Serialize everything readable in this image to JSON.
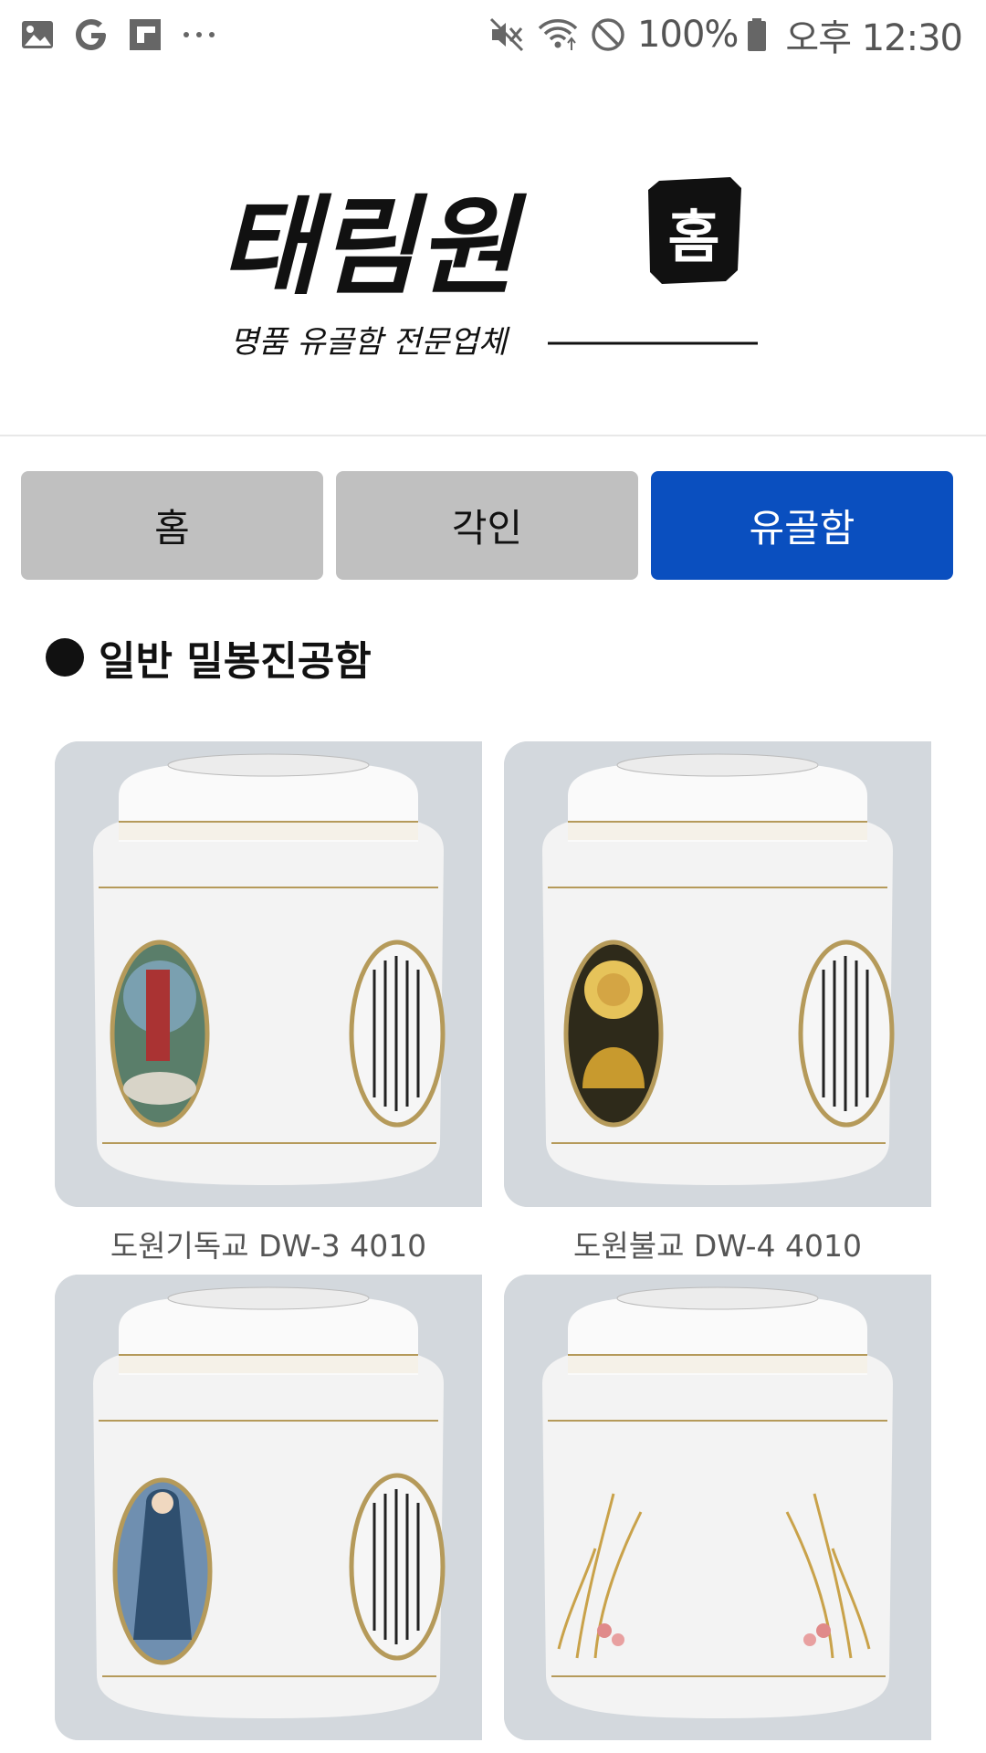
{
  "status_bar": {
    "left_icons": [
      "gallery-icon",
      "google-icon",
      "flipboard-icon",
      "more-dots-icon"
    ],
    "right_icons": [
      "mute-icon",
      "wifi-icon",
      "dnd-icon",
      "battery-icon"
    ],
    "battery": "100%",
    "time": "오후 12:30"
  },
  "header": {
    "logo_title": "태림원",
    "logo_seal": "홈",
    "logo_tagline": "명품 유골함 전문업체"
  },
  "nav": {
    "tabs": [
      {
        "label": "홈",
        "active": false
      },
      {
        "label": "각인",
        "active": false
      },
      {
        "label": "유골함",
        "active": true
      }
    ],
    "active_color": "#0a4fbf",
    "inactive_color": "#c0c0c0"
  },
  "section": {
    "title": "일반 밀봉진공함"
  },
  "products": [
    {
      "caption": "도원기독교 DW-3 4010",
      "image": "christian-urn-image"
    },
    {
      "caption": "도원불교 DW-4 4010",
      "image": "buddhist-urn-image"
    },
    {
      "caption": "",
      "image": "catholic-urn-image"
    },
    {
      "caption": "",
      "image": "orchid-urn-image"
    }
  ]
}
